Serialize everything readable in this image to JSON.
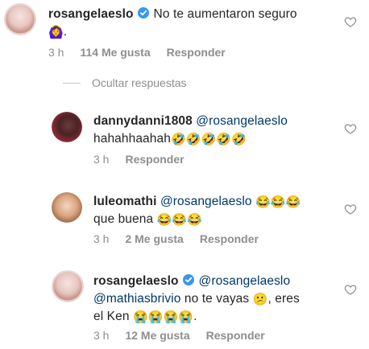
{
  "comment": {
    "username": "rosangelaeslo",
    "text": "No te aumentaron seguro",
    "emoji_after": "🙆‍♀️",
    "time": "3 h",
    "likes": "114 Me gusta",
    "reply": "Responder"
  },
  "hide_replies": "Ocultar respuestas",
  "replies": [
    {
      "username": "dannydanni1808",
      "mention": "@rosangelaeslo",
      "text": "hahahhaahah",
      "emojis": "🤣🤣🤣🤣🤣",
      "time": "3 h",
      "reply": "Responder"
    },
    {
      "username": "luleomathi",
      "mention": "@rosangelaeslo",
      "emojis_line1": "😂😂😂",
      "text_line2": "que buena",
      "emojis_line2": "😂😂😂",
      "time": "3 h",
      "likes": "2 Me gusta",
      "reply": "Responder"
    },
    {
      "username": "rosangelaeslo",
      "mention": "@rosangelaeslo",
      "mention2": "@mathiasbrivio",
      "text_a": "no te vayas",
      "emoji_a": "😕",
      "text_b": ", eres",
      "text_c": "el Ken",
      "emojis_c": "😭😭😭😭",
      "text_d": ".",
      "time": "3 h",
      "likes": "12 Me gusta",
      "reply": "Responder"
    }
  ],
  "colors": {
    "text": "#262626",
    "mention": "#00376b",
    "meta": "#8e8e8e",
    "verified": "#3897f0"
  },
  "icons": [
    "heart-icon",
    "verified-badge-icon"
  ]
}
